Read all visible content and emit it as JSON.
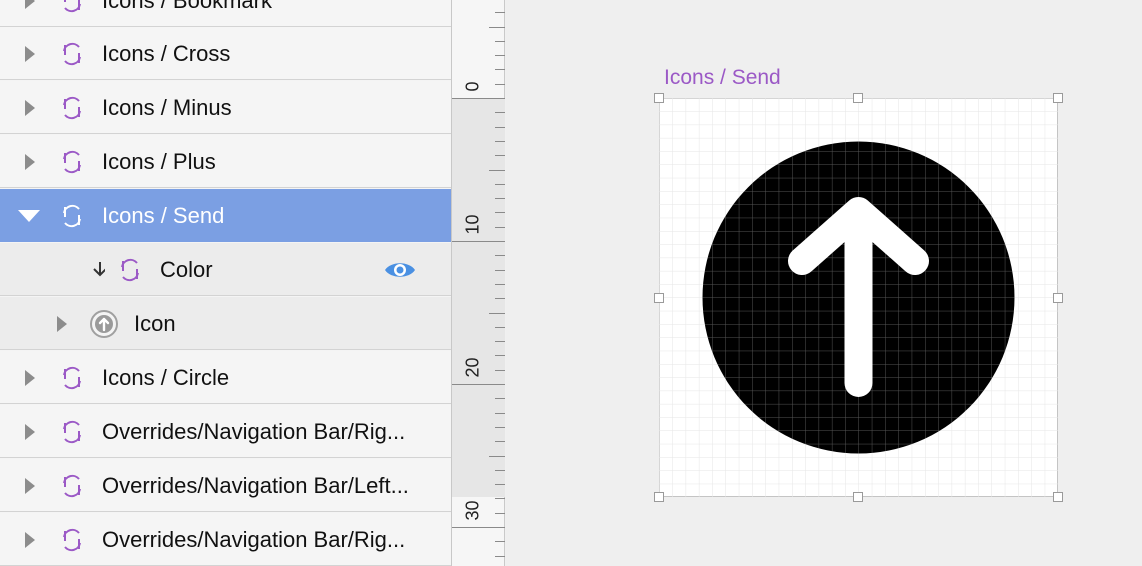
{
  "layers": {
    "rows": [
      {
        "label": "Icons / Bookmark"
      },
      {
        "label": "Icons / Cross"
      },
      {
        "label": "Icons / Minus"
      },
      {
        "label": "Icons / Plus"
      },
      {
        "label": "Icons / Send",
        "selected": true,
        "expanded": true
      },
      {
        "label": "Color",
        "child": true,
        "mask_arrow": true,
        "visibility": "eye-icon"
      },
      {
        "label": "Icon",
        "child": true,
        "icon": "arrow-up-circle-icon"
      },
      {
        "label": "Icons / Circle"
      },
      {
        "label": "Overrides/Navigation Bar/Rig..."
      },
      {
        "label": "Overrides/Navigation Bar/Left..."
      },
      {
        "label": "Overrides/Navigation Bar/Rig..."
      }
    ]
  },
  "ruler": {
    "labels": [
      "0",
      "10",
      "20",
      "30"
    ]
  },
  "canvas": {
    "artboard_title": "Icons / Send"
  },
  "colors": {
    "symbol_purple": "#9b59c6",
    "selection_blue": "#7b9fe3",
    "eye_blue": "#4a90e2"
  }
}
